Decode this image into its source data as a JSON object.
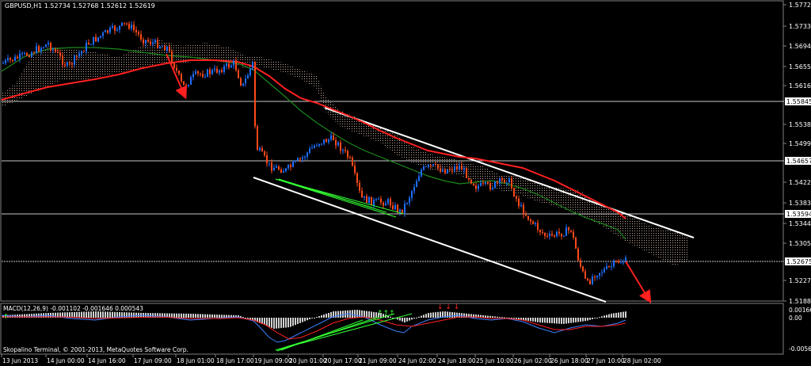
{
  "header": {
    "title": "GBPUSD,H1  1.52734 1.52768 1.52612 1.52619"
  },
  "price_axis": {
    "labels": [
      "1.57720",
      "1.57330",
      "1.56940",
      "1.56550",
      "1.56160",
      "1.55380",
      "1.54990",
      "1.54220",
      "1.53830",
      "1.53440",
      "1.53050",
      "1.52270",
      "1.51880"
    ],
    "highlighted": [
      "1.55845",
      "1.54657",
      "1.53594",
      "1.52675"
    ]
  },
  "macd": {
    "title": "MACD(12,26,9) -0.001102 -0.001646 0.000543",
    "axis": [
      "0.001663",
      "0.00",
      "-0.005694"
    ]
  },
  "time_axis": [
    "13 Jun 2013",
    "14 Jun 00:00",
    "14 Jun 16:00",
    "17 Jun 09:00",
    "18 Jun 01:00",
    "18 Jun 17:00",
    "19 Jun 09:00",
    "20 Jun 01:00",
    "20 Jun 17:00",
    "21 Jun 09:00",
    "24 Jun 02:00",
    "24 Jun 18:00",
    "25 Jun 10:00",
    "26 Jun 02:00",
    "26 Jun 18:00",
    "27 Jun 10:00",
    "28 Jun 02:00"
  ],
  "copyright": "Skopalino Terminal, © 2001-2013, MetaQuotes Software Corp.",
  "colors": {
    "bull": "#1e6fff",
    "bear": "#ff4a1a",
    "ma_fast": "#ff2020",
    "ma_slow": "#1a8a1a",
    "channel": "#ffffff",
    "cloud": "#d9b8a8",
    "macd_line": "#3a80ff",
    "signal_line": "#ff2020",
    "divergence": "#33ff33"
  }
}
